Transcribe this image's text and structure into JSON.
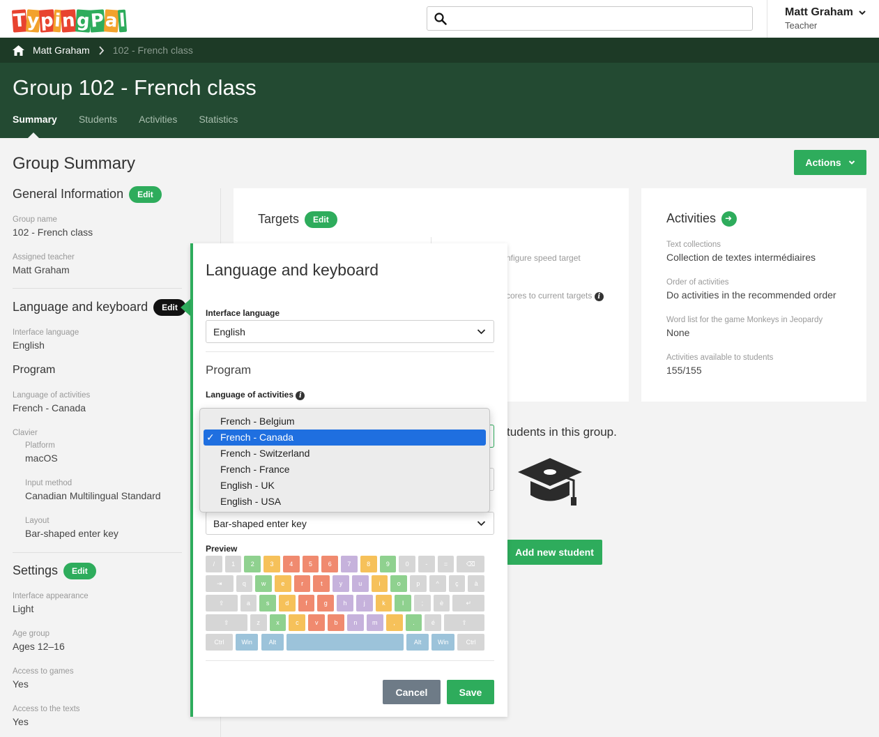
{
  "header": {
    "logo_letters": [
      "T",
      "y",
      "p",
      "i",
      "n",
      "g",
      "P",
      "a",
      "l"
    ],
    "user_name": "Matt Graham",
    "user_role": "Teacher",
    "search_placeholder": ""
  },
  "breadcrumb": {
    "home": "Matt Graham",
    "current": "102 - French class"
  },
  "group": {
    "prefix": "Group",
    "name": "102 - French class"
  },
  "tabs": [
    "Summary",
    "Students",
    "Activities",
    "Statistics"
  ],
  "summary": {
    "title": "Group Summary",
    "actions_label": "Actions",
    "general": {
      "heading": "General Information",
      "edit": "Edit",
      "group_name_label": "Group name",
      "group_name": "102 - French class",
      "teacher_label": "Assigned teacher",
      "teacher": "Matt Graham"
    },
    "language": {
      "heading": "Language and keyboard",
      "edit": "Edit",
      "interface_label": "Interface language",
      "interface": "English",
      "program": "Program",
      "activities_lang_label": "Language of activities",
      "activities_lang": "French - Canada",
      "clavier_label": "Clavier",
      "platform_label": "Platform",
      "platform": "macOS",
      "input_label": "Input method",
      "input": "Canadian Multilingual Standard",
      "layout_label": "Layout",
      "layout": "Bar-shaped enter key"
    },
    "settings": {
      "heading": "Settings",
      "edit": "Edit",
      "appearance_label": "Interface appearance",
      "appearance": "Light",
      "age_label": "Age group",
      "age": "Ages 12–16",
      "games_label": "Access to games",
      "games": "Yes",
      "texts_label": "Access to the texts",
      "texts": "Yes"
    }
  },
  "targets": {
    "heading": "Targets",
    "edit": "Edit",
    "partial1": "nfigure speed target",
    "partial2": "cores to current targets"
  },
  "activities": {
    "heading": "Activities",
    "collections_label": "Text collections",
    "collections": "Collection de textes intermédiaires",
    "order_label": "Order of activities",
    "order": "Do activities in the recommended order",
    "wordlist_label": "Word list for the game Monkeys in Jeopardy",
    "wordlist": "None",
    "available_label": "Activities available to students",
    "available": "155/155"
  },
  "students": {
    "message": "tudents in this group.",
    "add_label": "Add new student"
  },
  "popup": {
    "title": "Language and keyboard",
    "interface_label": "Interface language",
    "interface_value": "English",
    "program": "Program",
    "activities_label": "Language of activities",
    "layout_value": "Bar-shaped enter key",
    "preview_label": "Preview",
    "cancel": "Cancel",
    "save": "Save",
    "options": [
      "French - Belgium",
      "French - Canada",
      "French - Switzerland",
      "French - France",
      "English - UK",
      "English - USA"
    ],
    "selected_option": "French - Canada"
  },
  "keyboard_rows": [
    [
      "/",
      "1",
      "2",
      "3",
      "4",
      "5",
      "6",
      "7",
      "8",
      "9",
      "0",
      "-",
      "=",
      "⌫"
    ],
    [
      "⇥",
      "q",
      "w",
      "e",
      "r",
      "t",
      "y",
      "u",
      "i",
      "o",
      "p",
      "^",
      "ç",
      "à"
    ],
    [
      "⇪",
      "a",
      "s",
      "d",
      "f",
      "g",
      "h",
      "j",
      "k",
      "l",
      ";",
      "è",
      "↵"
    ],
    [
      "⇧",
      "z",
      "x",
      "c",
      "v",
      "b",
      "n",
      "m",
      ",",
      ".",
      "é",
      "⇧"
    ],
    [
      "Ctrl",
      "Win",
      "Alt",
      "",
      "Alt",
      "Win",
      "Ctrl"
    ]
  ],
  "colors": {
    "accent": "#2eac5c",
    "header_dark": "#1d3a26",
    "header_green": "#234a32",
    "select_blue": "#1f6fe0",
    "cancel_gray": "#6e7b87"
  }
}
